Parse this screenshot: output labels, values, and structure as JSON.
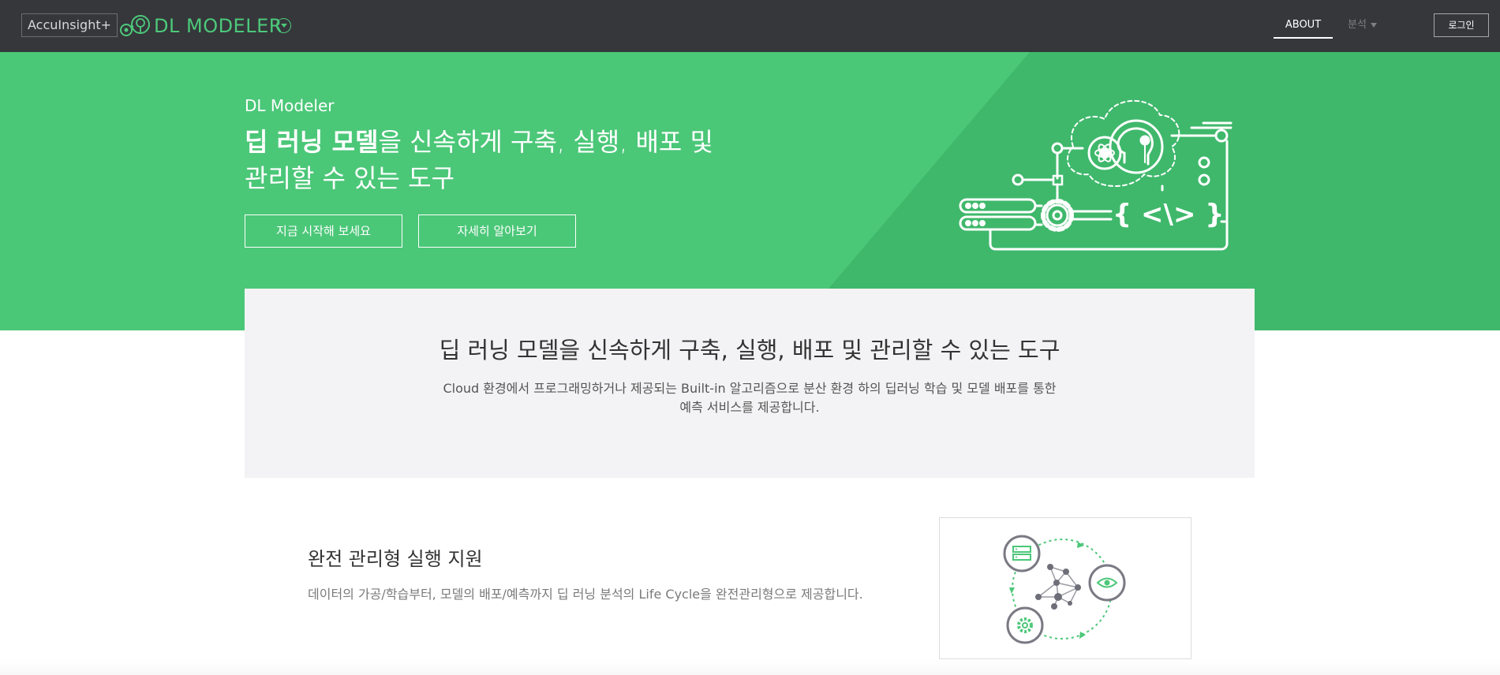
{
  "topbar": {
    "acc_logo": "AccuInsight+",
    "brand": "DL MODELER",
    "nav_about": "ABOUT",
    "nav_analysis": "분석",
    "login": "로그인"
  },
  "hero": {
    "subtitle": "DL Modeler",
    "title_bold": "딥 러닝 모델",
    "title_rest": "을 신속하게 구축, 실행, 배포 및 관리할 수 있는 도구",
    "btn_start": "지금 시작해 보세요",
    "btn_learn": "자세히 알아보기"
  },
  "intro": {
    "heading": "딥 러닝 모델을 신속하게 구축, 실행, 배포 및 관리할 수 있는 도구",
    "desc": "Cloud 환경에서 프로그래밍하거나 제공되는 Built-in 알고리즘으로 분산 환경 하의 딥러닝 학습 및 모델 배포를 통한 예측 서비스를 제공합니다."
  },
  "feature": {
    "title": "완전 관리형 실행 지원",
    "desc": "데이터의 가공/학습부터, 모델의 배포/예측까지 딥 러닝 분석의 Life Cycle을 완전관리형으로 제공합니다."
  },
  "colors": {
    "topbar": "#35373b",
    "accent": "#4bc778",
    "hero_dark": "#3fb86b",
    "intro_bg": "#f3f3f5"
  },
  "icons": [
    "brain-network-icon",
    "dropdown-chevron-icon",
    "dl-pipeline-illustration",
    "server-icon",
    "eye-icon",
    "gear-icon",
    "network-graph-icon"
  ]
}
